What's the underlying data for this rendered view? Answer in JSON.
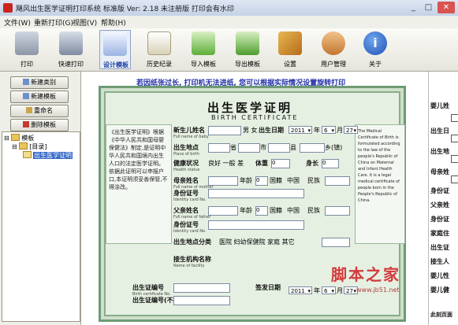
{
  "window": {
    "title": "飓风出生医学证明打印系统 标准版   Ver: 2.18  未注册版 打印会有水印"
  },
  "menu": [
    "文件(W)",
    "重新打印(G)",
    "视图(V)",
    "帮助(H)"
  ],
  "toolbar": [
    {
      "label": "打印",
      "icon": "printer-icon"
    },
    {
      "label": "快速打印",
      "icon": "fast-print-icon"
    },
    {
      "label": "设计模板",
      "icon": "design-template-icon"
    },
    {
      "label": "历史纪录",
      "icon": "history-icon"
    },
    {
      "label": "导入模板",
      "icon": "import-icon"
    },
    {
      "label": "导出模板",
      "icon": "export-icon"
    },
    {
      "label": "设置",
      "icon": "settings-icon"
    },
    {
      "label": "用户管理",
      "icon": "users-icon"
    },
    {
      "label": "关于",
      "icon": "info-icon"
    }
  ],
  "left": {
    "buttons": [
      "新建类别",
      "新建模板",
      "重命名",
      "删除模板"
    ],
    "tree": {
      "root": "模板",
      "child": "[目录]",
      "leaf": "出生医学证明"
    }
  },
  "notice": "若因纸张过长, 打印机无法进纸, 您可以根据实际情况设置旋转打印",
  "cert": {
    "title": "出生医学证明",
    "subtitle": "BIRTH CERTIFICATE",
    "fields": {
      "name_label": "新生儿姓名",
      "name_en": "Full name of baby",
      "sex_label": "男",
      "sex2_label": "女",
      "sex_en": "Male Female",
      "dob_label": "出生日期",
      "dob_en": "Date of birth",
      "dob_year": "2011",
      "dob_month": "6",
      "dob_day": "27",
      "dob_hour": "0",
      "yr": "年",
      "mo": "月",
      "dy": "日",
      "hr": "时",
      "min_label": "分",
      "dob_min": "0",
      "place_label": "出生地点",
      "place_en": "Place of birth",
      "prov": "省",
      "city": "市",
      "county": "县",
      "township": "乡(镇)",
      "health_label": "健康状况",
      "health_en": "Health status",
      "good": "良好",
      "normal": "一般",
      "weak": "差",
      "weight_label": "体重",
      "weight_unit": "克",
      "weight_val": "0",
      "height_label": "身长",
      "height_unit": "厘米",
      "height_val": "0",
      "gest_label": "出生孕周",
      "gest_en": "Gestational weeks",
      "gest_val": "0",
      "mother_label": "母亲姓名",
      "mother_en": "Full name of mother",
      "age": "年龄",
      "age_val": "0",
      "nation": "国籍",
      "ethnic": "民族",
      "nation_val": "中国",
      "id_label": "身份证号",
      "id_en": "Identity card No.",
      "father_label": "父亲姓名",
      "father_en": "Full name of father",
      "place_type": "出生地点分类",
      "hospital": "医院",
      "mch": "妇幼保健院",
      "home": "家庭",
      "other": "其它",
      "inst_label": "接生机构名称",
      "inst_en": "Name of facility",
      "cert_no": "出生证编号",
      "cert_no_en": "Birth certificate No.",
      "issue_date": "签发日期",
      "issue_year": "2011",
      "issue_month": "6",
      "issue_day": "27",
      "unprinted": "出生证编号(不打印)"
    },
    "left_text": "《出生医学证明》根据《中华人民共和国母婴保健法》制定,是证明中华人民共和国境内出生人口的法定医学证明。依据此证明可以申报户口,本证明须妥善保管,不得涂改。",
    "right_text": "The Medical Certificate of Birth is formulated according to the law of the people's Republic of China on Maternal and Infant Health Care. It is a legal medical certificate of people born in the People's Republic of China."
  },
  "right_strip": [
    "婴儿姓",
    "出生日",
    "出生地",
    "母亲姓",
    "身份证",
    "父亲姓",
    "身份证",
    "家庭住",
    "出生证",
    "接生人",
    "婴儿性",
    "婴儿健",
    "此刻页面"
  ],
  "watermark": {
    "text": "脚本之家",
    "url": "www.jb51.net"
  },
  "colors": {
    "cert_border": "#6e9a74",
    "notice": "#1f2ea8",
    "accent": "#3163c5"
  }
}
